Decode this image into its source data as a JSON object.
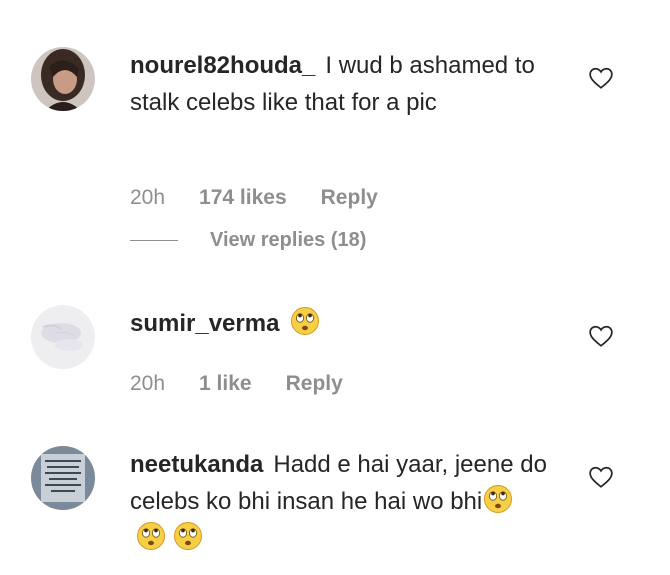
{
  "comments": [
    {
      "username": "nourel82houda_",
      "text": "I wud b ashamed to stalk celebs like that for a pic",
      "time": "20h",
      "likes": "174 likes",
      "reply": "Reply",
      "view_replies": "View replies (18)"
    },
    {
      "username": "sumir_verma",
      "text": "",
      "emoji_count": 1,
      "emoji": "face-with-rolling-eyes-icon",
      "time": "20h",
      "likes": "1 like",
      "reply": "Reply"
    },
    {
      "username": "neetukanda",
      "text": "Hadd e hai yaar, jeene do celebs ko bhi insan he hai wo bhi",
      "emoji_count": 3,
      "emoji": "face-with-rolling-eyes-icon"
    }
  ],
  "colors": {
    "text": "#262626",
    "muted": "#8e8e8e",
    "emoji_yellow": "#f7cf46"
  }
}
